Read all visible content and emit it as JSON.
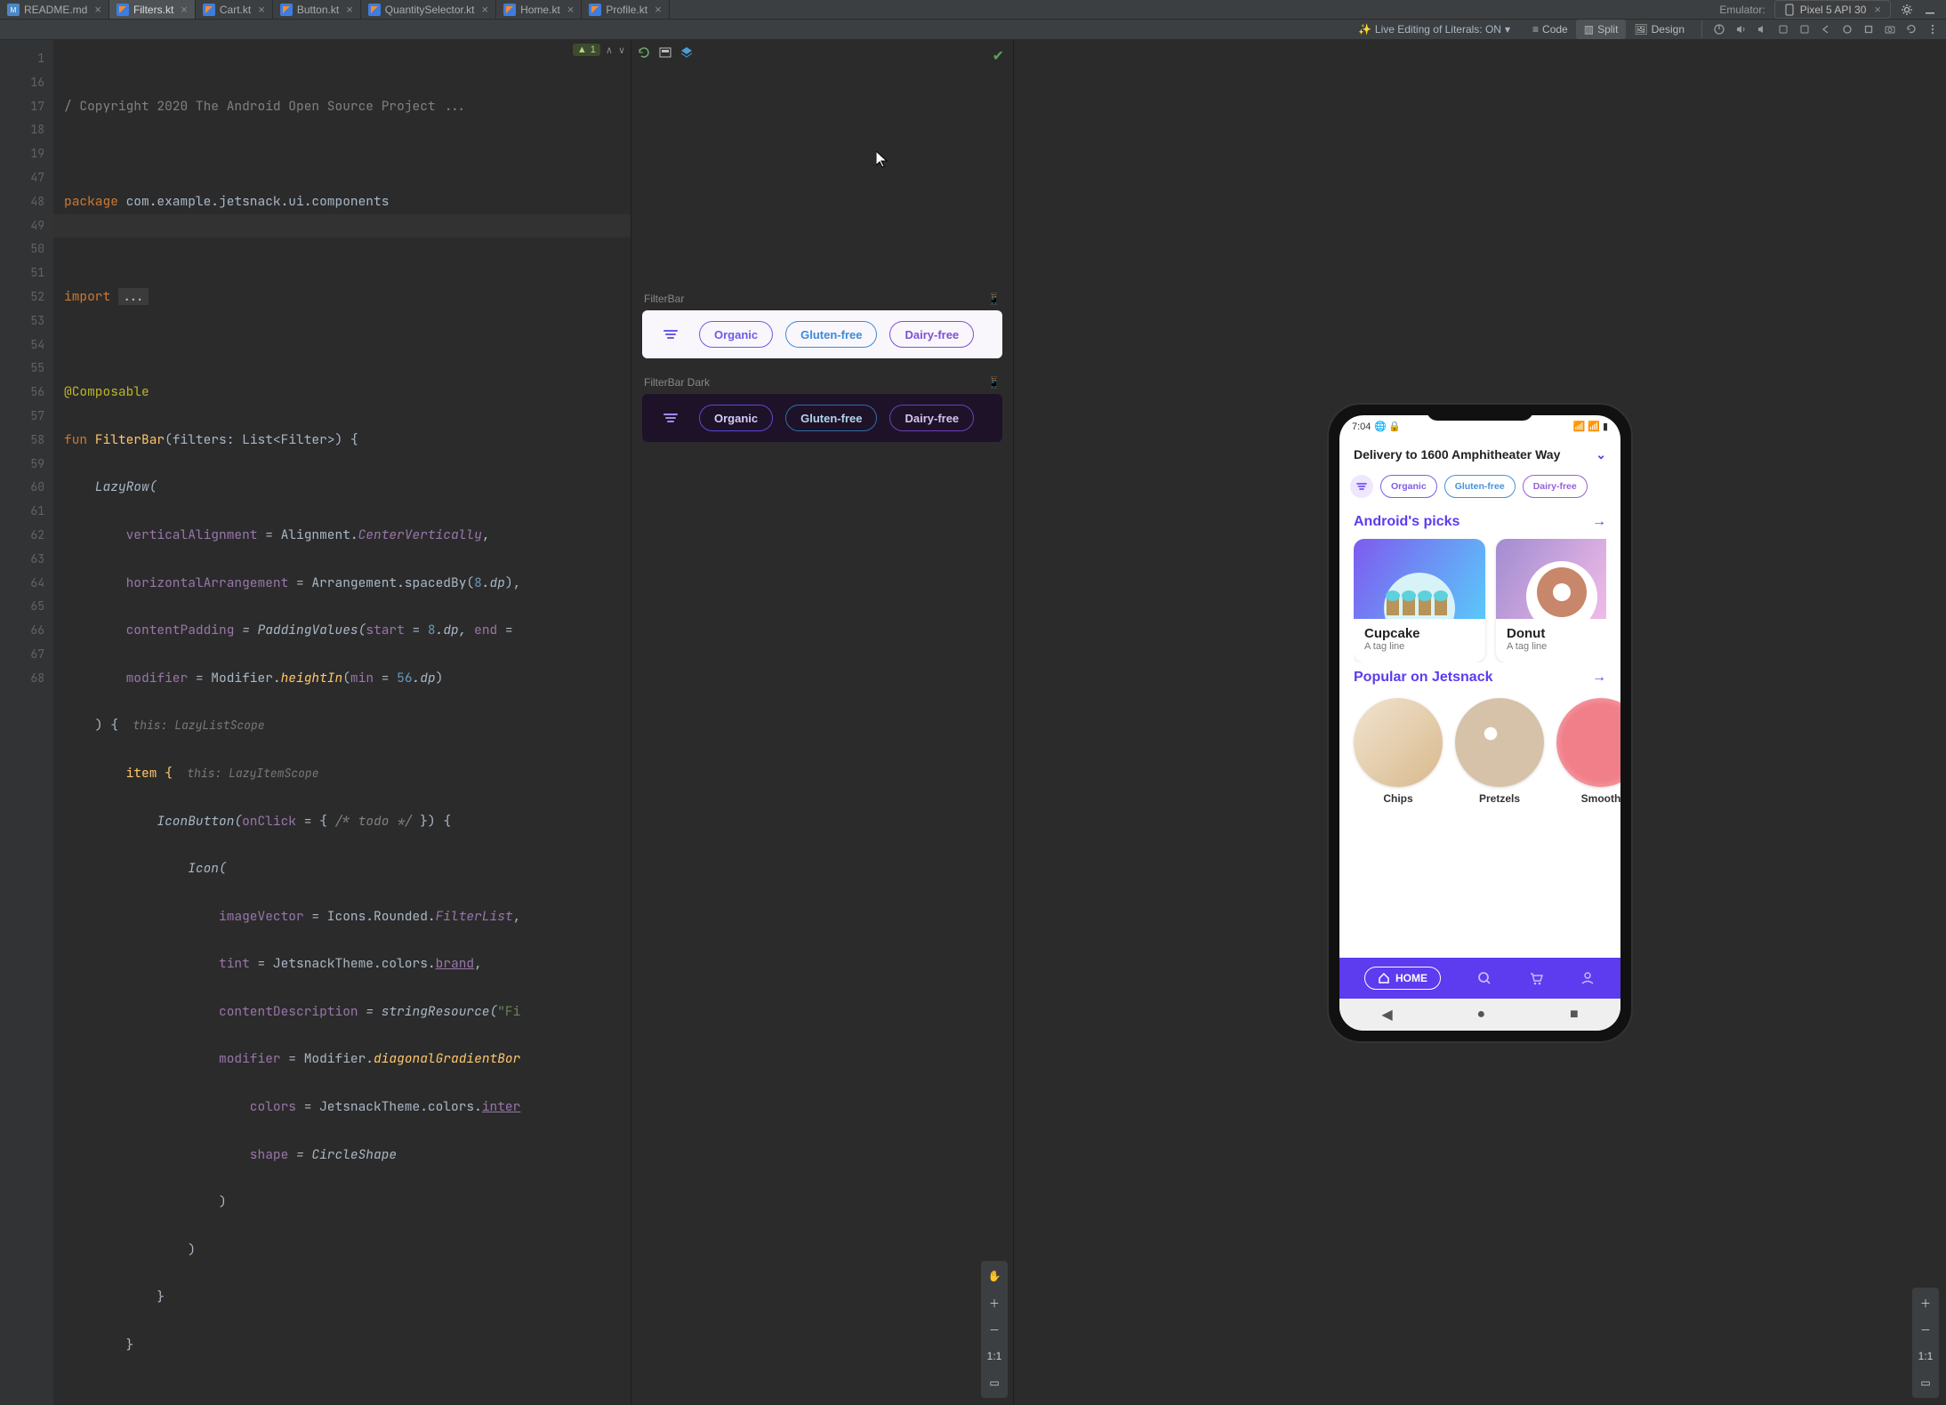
{
  "tabs": [
    {
      "icon": "readme",
      "label": "README.md"
    },
    {
      "icon": "kt",
      "label": "Filters.kt",
      "active": true
    },
    {
      "icon": "kt",
      "label": "Cart.kt"
    },
    {
      "icon": "kt",
      "label": "Button.kt"
    },
    {
      "icon": "kt",
      "label": "QuantitySelector.kt"
    },
    {
      "icon": "kt",
      "label": "Home.kt"
    },
    {
      "icon": "kt",
      "label": "Profile.kt"
    }
  ],
  "header": {
    "emulator_label": "Emulator:",
    "device": "Pixel 5 API 30"
  },
  "subbar": {
    "live_edit": "Live Editing of Literals: ON",
    "code": "Code",
    "split": "Split",
    "design": "Design"
  },
  "editor": {
    "badge": "1",
    "gutter_lines": [
      "1",
      "16",
      "17",
      "18",
      "19",
      "47",
      "48",
      "49",
      "50",
      "51",
      "52",
      "53",
      "54",
      "55",
      "56",
      "57",
      "58",
      "59",
      "60",
      "61",
      "62",
      "63",
      "64",
      "65",
      "66",
      "67",
      "68"
    ]
  },
  "code": {
    "l1_a": "/",
    "l1_b": " Copyright 2020 The Android Open Source Project ...",
    "l3_kw": "package",
    "l3_pkg": " com.example.jetsnack.ui.components",
    "l5_kw": "import ",
    "l5_dots": "...",
    "l7_anno": "@Composable",
    "l8_kw": "fun ",
    "l8_name": "FilterBar",
    "l8_sig": "(filters: List<Filter>) {",
    "l9": "    LazyRow(",
    "l10_a": "        verticalAlignment",
    "l10_b": " = Alignment.",
    "l10_c": "CenterVertically",
    "l10_d": ",",
    "l11_a": "        horizontalArrangement",
    "l11_b": " = Arrangement.spacedBy(",
    "l11_c": "8",
    "l11_d": ".dp",
    "l11_e": "),",
    "l12_a": "        contentPadding",
    "l12_b": " = PaddingValues(",
    "l12_c": "start",
    "l12_d": " = ",
    "l12_e": "8",
    "l12_f": ".dp, ",
    "l12_g": "end",
    "l12_h": " = ",
    "l13_a": "        modifier",
    "l13_b": " = Modifier.",
    "l13_c": "heightIn",
    "l13_d": "(",
    "l13_e": "min",
    "l13_f": " = ",
    "l13_g": "56",
    "l13_h": ".dp",
    "l13_i": ")",
    "l14_a": "    ) { ",
    "l14_hint": " this: LazyListScope ",
    "l15_a": "        item { ",
    "l15_hint": " this: LazyItemScope ",
    "l16_a": "            IconButton(",
    "l16_b": "onClick",
    "l16_c": " = { ",
    "l16_d": "/* todo */",
    "l16_e": " }) {",
    "l17": "                Icon(",
    "l18_a": "                    imageVector",
    "l18_b": " = Icons.Rounded.",
    "l18_c": "FilterList",
    "l18_d": ",",
    "l19_a": "                    tint",
    "l19_b": " = JetsnackTheme.colors.",
    "l19_c": "brand",
    "l19_d": ",",
    "l20_a": "                    contentDescription",
    "l20_b": " = stringResource(",
    "l20_c": "\"Fi",
    "l21_a": "                    modifier",
    "l21_b": " = Modifier.",
    "l21_c": "diagonalGradientBor",
    "l22_a": "                        colors",
    "l22_b": " = JetsnackTheme.colors.",
    "l22_c": "inter",
    "l23_a": "                        shape",
    "l23_b": " = CircleShape",
    "l24": "                    )",
    "l25": "                )",
    "l26": "            }",
    "l27": "        }"
  },
  "preview": {
    "light_label": "FilterBar",
    "dark_label": "FilterBar Dark",
    "chips": [
      "Organic",
      "Gluten-free",
      "Dairy-free"
    ]
  },
  "side_tool": {
    "one_to_one": "1:1"
  },
  "phone": {
    "time": "7:04",
    "delivery": "Delivery to 1600 Amphitheater Way",
    "chips": [
      "Organic",
      "Gluten-free",
      "Dairy-free"
    ],
    "sec1": "Android's picks",
    "card1_title": "Cupcake",
    "card1_sub": "A tag line",
    "card2_title": "Donut",
    "card2_sub": "A tag line",
    "sec2": "Popular on Jetsnack",
    "pop": [
      "Chips",
      "Pretzels",
      "Smooth"
    ],
    "nav_home": "HOME"
  }
}
